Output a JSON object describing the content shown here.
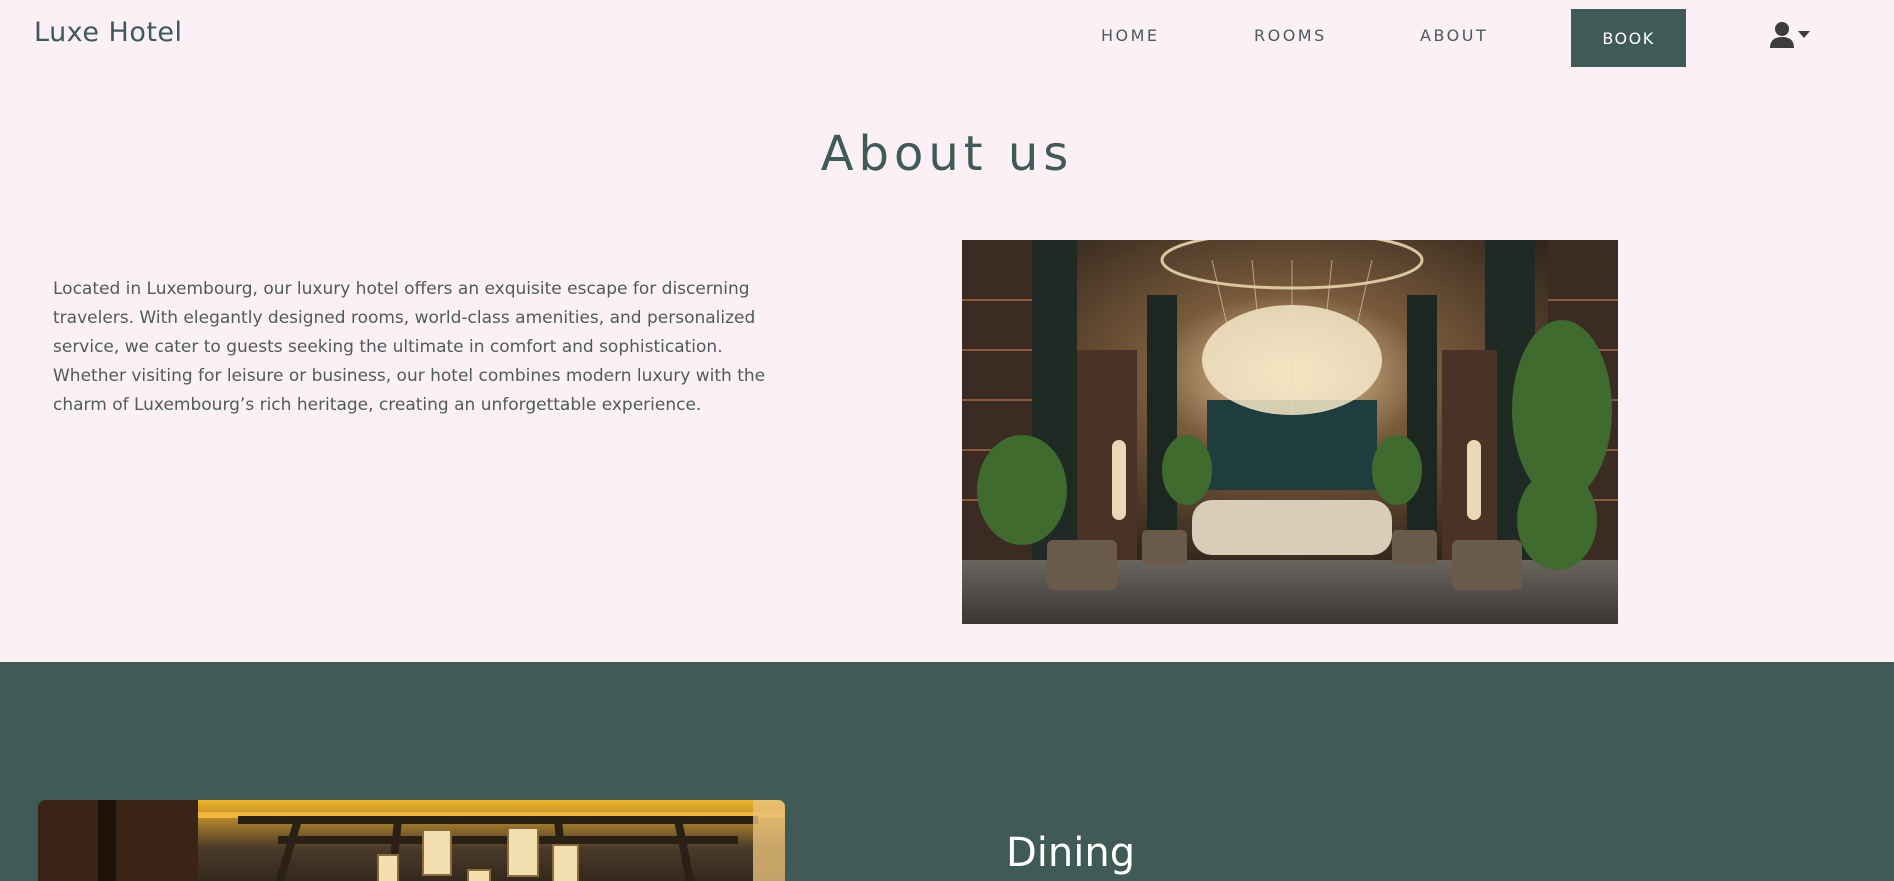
{
  "header": {
    "brand": "Luxe Hotel",
    "nav": {
      "home": "HOME",
      "rooms": "ROOMS",
      "about": "ABOUT",
      "book": "BOOK"
    },
    "user_icon": "user-icon",
    "dropdown_icon": "caret-down-icon"
  },
  "about": {
    "title": "About us",
    "text": "Located in Luxembourg, our luxury hotel offers an exquisite escape for discerning travelers. With elegantly designed rooms, world-class amenities, and personalized service, we cater to guests seeking the ultimate in comfort and sophistication. Whether visiting for leisure or business, our hotel combines modern luxury with the charm of Luxembourg’s rich heritage, creating an unforgettable experience."
  },
  "dining": {
    "title": "Dining"
  },
  "colors": {
    "page_background": "#fbf0f5",
    "accent": "#405a56",
    "text": "#4f5b5a"
  }
}
